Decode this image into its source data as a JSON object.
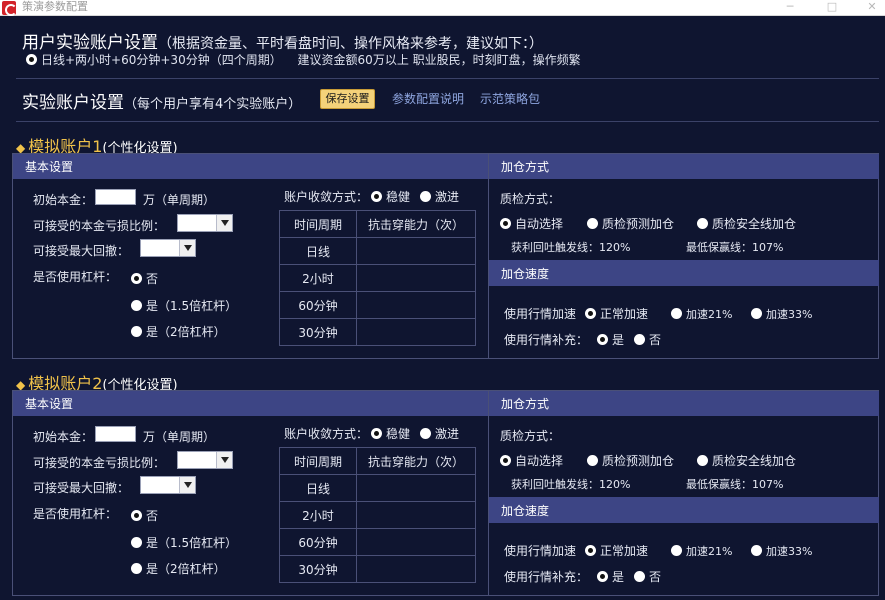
{
  "window": {
    "title": "策演参数配置"
  },
  "header": {
    "title": "用户实验账户设置",
    "subtitle": "（根据资金量、平时看盘时间、操作风格来参考，建议如下：）",
    "period_option": "日线+两小时+60分钟+30分钟（四个周期）",
    "advice": "建议资金额60万以上 职业股民，时刻盯盘，操作频繁"
  },
  "settings": {
    "title": "实验账户设置",
    "subtitle": "（每个用户享有4个实验账户）",
    "save_label": "保存设置",
    "link_params": "参数配置说明",
    "link_demo": "示范策略包"
  },
  "accounts": [
    {
      "title": "模拟账户1",
      "subtitle": "(个性化设置)",
      "basic_header": "基本设置",
      "add_header": "加仓方式",
      "speed_header": "加仓速度",
      "capital_label": "初始本金：",
      "capital_unit": "万（单周期）",
      "loss_label": "可接受的本金亏损比例：",
      "drawdown_label": "可接受最大回撤：",
      "leverage_label": "是否使用杠杆：",
      "leverage_options": [
        "否",
        "是（1.5倍杠杆）",
        "是（2倍杠杆）"
      ],
      "converge_label": "账户收敛方式：",
      "converge_options": [
        "稳健",
        "激进"
      ],
      "table_headers": [
        "时间周期",
        "抗击穿能力（次）"
      ],
      "periods": [
        "日线",
        "2小时",
        "60分钟",
        "30分钟"
      ],
      "check_label": "质检方式：",
      "check_options": [
        "自动选择",
        "质检预测加仓",
        "质检安全线加仓"
      ],
      "rebound_line": "获利回吐触发线：120%",
      "min_profit_line": "最低保赢线：107%",
      "speed_label": "使用行情加速",
      "speed_options": [
        "正常加速",
        "加速21%",
        "加速33%"
      ],
      "supplement_label": "使用行情补充：",
      "supplement_options": [
        "是",
        "否"
      ]
    },
    {
      "title": "模拟账户2",
      "subtitle": "(个性化设置)",
      "basic_header": "基本设置",
      "add_header": "加仓方式",
      "speed_header": "加仓速度",
      "capital_label": "初始本金：",
      "capital_unit": "万（单周期）",
      "loss_label": "可接受的本金亏损比例：",
      "drawdown_label": "可接受最大回撤：",
      "leverage_label": "是否使用杠杆：",
      "leverage_options": [
        "否",
        "是（1.5倍杠杆）",
        "是（2倍杠杆）"
      ],
      "converge_label": "账户收敛方式：",
      "converge_options": [
        "稳健",
        "激进"
      ],
      "table_headers": [
        "时间周期",
        "抗击穿能力（次）"
      ],
      "periods": [
        "日线",
        "2小时",
        "60分钟",
        "30分钟"
      ],
      "check_label": "质检方式：",
      "check_options": [
        "自动选择",
        "质检预测加仓",
        "质检安全线加仓"
      ],
      "rebound_line": "获利回吐触发线：120%",
      "min_profit_line": "最低保赢线：107%",
      "speed_label": "使用行情加速",
      "speed_options": [
        "正常加速",
        "加速21%",
        "加速33%"
      ],
      "supplement_label": "使用行情补充：",
      "supplement_options": [
        "是",
        "否"
      ]
    }
  ]
}
